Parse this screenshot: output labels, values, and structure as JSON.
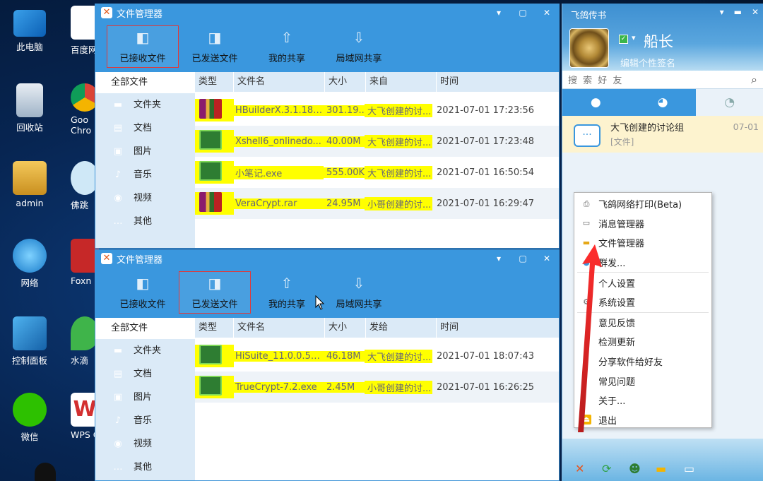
{
  "desktop": {
    "icons": [
      {
        "label": "此电脑"
      },
      {
        "label": "回收站"
      },
      {
        "label": "admin"
      },
      {
        "label": "网络"
      },
      {
        "label": "控制面板"
      },
      {
        "label": "微信"
      }
    ],
    "icons2": [
      {
        "label": "百度网"
      },
      {
        "label": "Goo Chro"
      },
      {
        "label": "佛跳"
      },
      {
        "label": "Foxn"
      },
      {
        "label": "水滴"
      },
      {
        "label": "WPS C"
      }
    ]
  },
  "window1": {
    "title": "文件管理器",
    "controls": [
      "▾",
      "▢",
      "✕"
    ],
    "toolbar": [
      "已接收文件",
      "已发送文件",
      "我的共享",
      "局域网共享"
    ],
    "sidebar": {
      "all": "全部文件",
      "items": [
        "文件夹",
        "文档",
        "图片",
        "音乐",
        "视频",
        "其他"
      ]
    },
    "columns": [
      "类型",
      "文件名",
      "大小",
      "来自",
      "时间"
    ],
    "rows": [
      {
        "type": "rar",
        "name": "HBuilderX.3.1.18....",
        "size": "301.19...",
        "from": "大飞创建的讨...",
        "time": "2021-07-01 17:23:56"
      },
      {
        "type": "exe",
        "name": "Xshell6_onlinedo...",
        "size": "40.00M",
        "from": "大飞创建的讨...",
        "time": "2021-07-01 17:23:48"
      },
      {
        "type": "exe",
        "name": "小笔记.exe",
        "size": "555.00K",
        "from": "大飞创建的讨...",
        "time": "2021-07-01 16:50:54"
      },
      {
        "type": "rar",
        "name": "VeraCrypt.rar",
        "size": "24.95M",
        "from": "小哥创建的讨...",
        "time": "2021-07-01 16:29:47"
      }
    ]
  },
  "window2": {
    "title": "文件管理器",
    "controls": [
      "▾",
      "▢",
      "✕"
    ],
    "toolbar": [
      "已接收文件",
      "已发送文件",
      "我的共享",
      "局域网共享"
    ],
    "sidebar": {
      "all": "全部文件",
      "items": [
        "文件夹",
        "文档",
        "图片",
        "音乐",
        "视频",
        "其他"
      ]
    },
    "columns": [
      "类型",
      "文件名",
      "大小",
      "发给",
      "时间"
    ],
    "rows": [
      {
        "type": "exe",
        "name": "HiSuite_11.0.0.55...",
        "size": "46.18M",
        "from": "大飞创建的讨...",
        "time": "2021-07-01 18:07:43"
      },
      {
        "type": "exe",
        "name": "TrueCrypt-7.2.exe",
        "size": "2.45M",
        "from": "小哥创建的讨...",
        "time": "2021-07-01 16:26:25"
      }
    ]
  },
  "feige": {
    "title": "飞鸽传书",
    "nickname": "船长",
    "signature": "编辑个性签名",
    "search_placeholder": "搜 索 好 友",
    "conversation": {
      "name": "大飞创建的讨论组",
      "snippet": "[文件]",
      "date": "07-01"
    }
  },
  "menu": {
    "items": [
      "飞鸽网络打印(Beta)",
      "消息管理器",
      "文件管理器",
      "群发...",
      "个人设置",
      "系统设置",
      "意见反馈",
      "检测更新",
      "分享软件给好友",
      "常见问题",
      "关于...",
      "退出"
    ]
  },
  "colors": {
    "accent": "#3a97de",
    "highlight": "#ffff00",
    "selected_border": "#e03a3a"
  }
}
